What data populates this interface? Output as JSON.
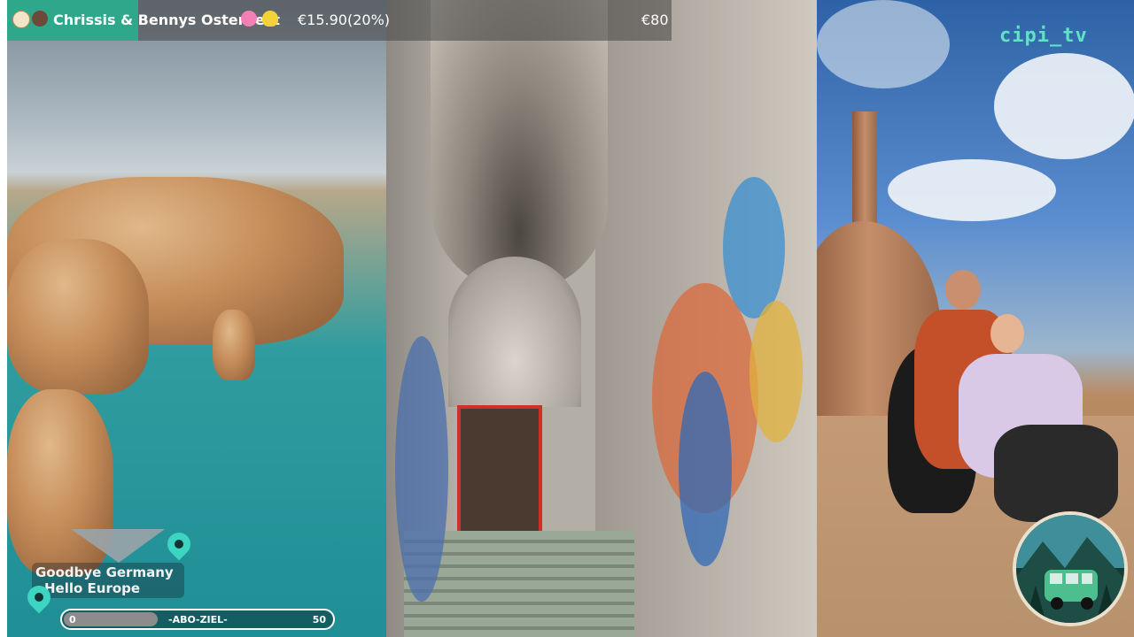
{
  "overlay": {
    "title": "Chrissis & Bennys Osternest",
    "amount": "€15.90(20%)",
    "goal": "€80",
    "channel": "cipi_tv",
    "logo_line1": "Goodbye Germany",
    "logo_line2": "Hello Europe",
    "progress_start": "0",
    "progress_label": "-ABO-ZIEL-",
    "progress_end": "50",
    "progress_fraction": 0.35
  },
  "icons": [
    "egg-icon",
    "dog-icon",
    "flower-icon",
    "heart-icon",
    "map-pin-icon",
    "van-badge-icon"
  ],
  "colors": {
    "accent_green": "#2fa78b",
    "channel_cyan": "#5fe3c4"
  }
}
